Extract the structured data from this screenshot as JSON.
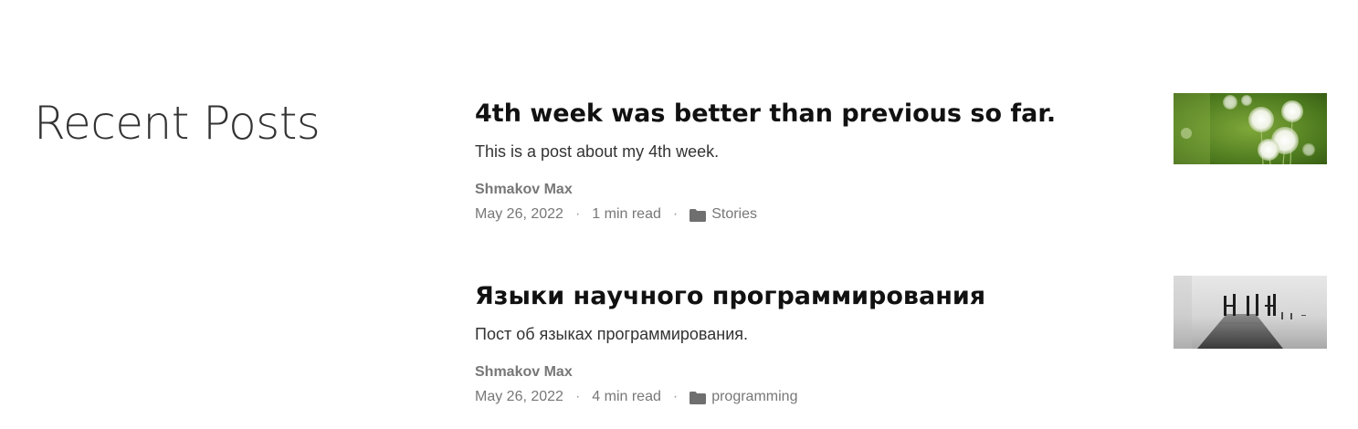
{
  "section": {
    "title": "Recent Posts"
  },
  "posts": [
    {
      "title": "4th week was better than previous so far.",
      "excerpt": "This is a post about my 4th week.",
      "author": "Shmakov Max",
      "date": "May 26, 2022",
      "separator": "·",
      "read_time": "1 min read",
      "category": "Stories",
      "category_icon": "folder-icon",
      "thumbnail": "dandelion-field-image"
    },
    {
      "title": "Языки научного программирования",
      "excerpt": "Пост об языках программирования.",
      "author": "Shmakov Max",
      "date": "May 26, 2022",
      "separator": "·",
      "read_time": "4 min read",
      "category": "programming",
      "category_icon": "folder-icon",
      "thumbnail": "misty-pier-image"
    }
  ]
}
